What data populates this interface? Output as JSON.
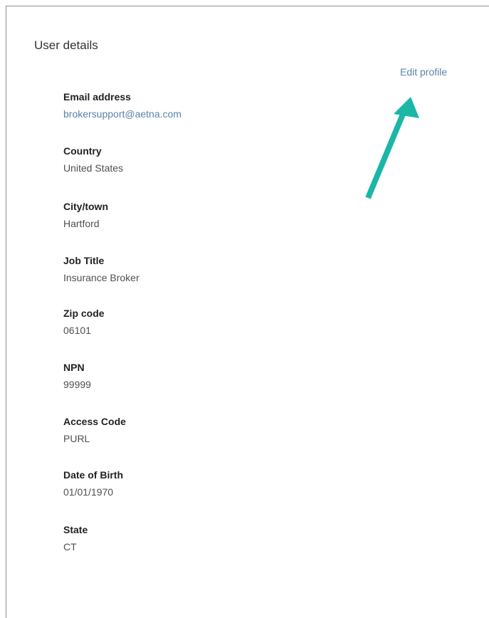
{
  "section": {
    "title": "User details",
    "edit_label": "Edit profile"
  },
  "fields": [
    {
      "label": "Email address",
      "value": "brokersupport@aetna.com"
    },
    {
      "label": "Country",
      "value": "United States"
    },
    {
      "label": "City/town",
      "value": "Hartford"
    },
    {
      "label": "Job Title",
      "value": "Insurance Broker"
    },
    {
      "label": "Zip code",
      "value": "06101"
    },
    {
      "label": "NPN",
      "value": "99999"
    },
    {
      "label": "Access Code",
      "value": "PURL"
    },
    {
      "label": "Date of Birth",
      "value": "01/01/1970"
    },
    {
      "label": "State",
      "value": "CT"
    }
  ],
  "colors": {
    "link": "#5b83a8",
    "annotation_arrow": "#1ab7a7"
  },
  "icons": {
    "annotation": "arrow-up-right-icon"
  }
}
